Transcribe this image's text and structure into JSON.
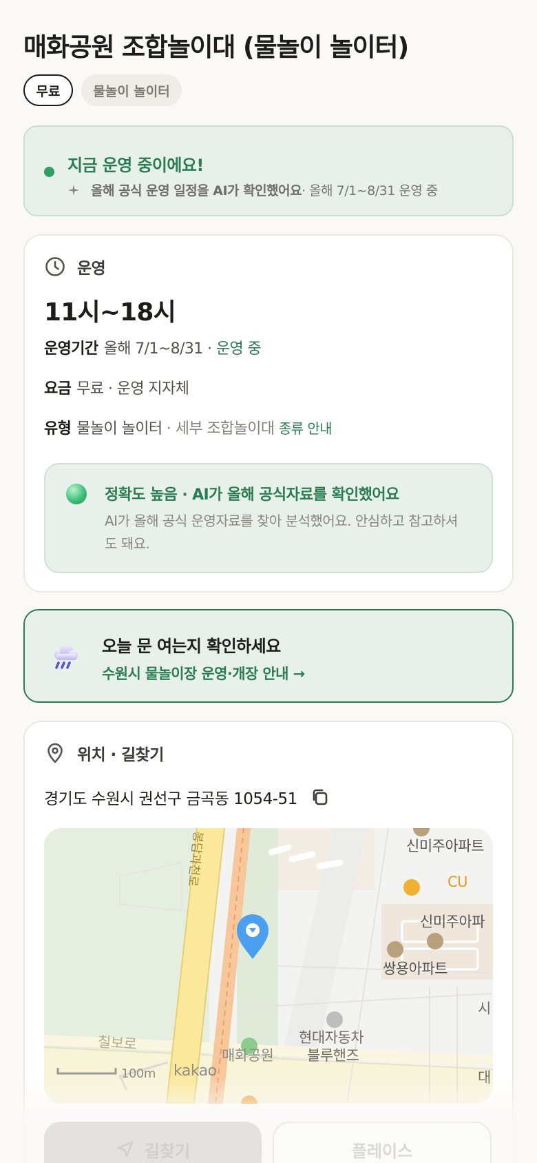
{
  "header": {
    "title": "매화공원 조합놀이대 (물놀이 놀이터)",
    "chips": [
      "무료",
      "물놀이 놀이터"
    ]
  },
  "status": {
    "title": "지금 운영 중이에요!",
    "sub_bold": "올해 공식 운영 일정을 AI가 확인했어요",
    "sub_rest": " · 올해 7/1~8/31 운영 중",
    "accent": "#2a7d52"
  },
  "operation": {
    "section_label": "운영",
    "hours": "11시~18시",
    "period_label": "운영기간",
    "period_value": "올해 7/1~8/31",
    "period_sep": " · ",
    "period_status": "운영 중",
    "fee_label": "요금",
    "fee_value": "무료 · 운영 지자체",
    "type_label": "유형",
    "type_value": "물놀이 놀이터",
    "type_detail": " · 세부 조합놀이대 ",
    "type_link": "종류 안내",
    "accuracy_title": "정확도 높음 · AI가 올해 공식자료를 확인했어요",
    "accuracy_desc": "AI가 올해 공식 운영자료를 찾아 분석했어요. 안심하고 참고하셔도 돼요."
  },
  "notice": {
    "title": "오늘 문 여는지 확인하세요",
    "link": "수원시 물놀이장 운영·개장 안내 →"
  },
  "location": {
    "section_label": "위치 · 길찾기",
    "address": "경기도 수원시 권선구 금곡동 1054-51",
    "map_labels": {
      "road_vertical": "봉담과천로",
      "road_bottom": "칠보로",
      "apt1": "신미주아파트",
      "cu": "CU",
      "apt2": "신미주아파",
      "apt3": "쌍용아파트",
      "park": "매화공원",
      "hyundai1": "현대자동차",
      "hyundai2": "블루핸즈",
      "edge1": "시",
      "edge2": "대",
      "scale": "100m",
      "brand": "kakao"
    }
  },
  "buttons": {
    "route": "길찾기",
    "place": "플레이스"
  }
}
